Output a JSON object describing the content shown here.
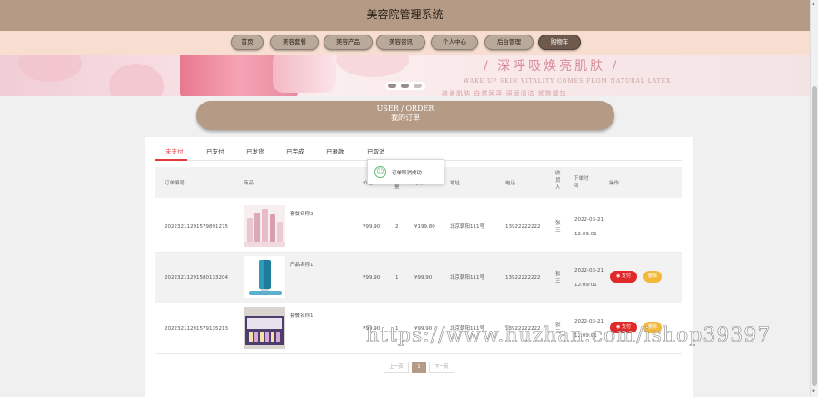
{
  "header": {
    "title": "美容院管理系统"
  },
  "nav": [
    {
      "label": "首页"
    },
    {
      "label": "美容套餐"
    },
    {
      "label": "美容产品"
    },
    {
      "label": "美容资讯"
    },
    {
      "label": "个人中心"
    },
    {
      "label": "后台管理"
    },
    {
      "label": "购物车"
    }
  ],
  "banner": {
    "slogan": "/ 深呼吸焕亮肌肤 /",
    "sub1": "WAKE UP SKIN VITALITY COMES FROM NATURAL LATEX",
    "sub2": "改善肌肤   自然润泽   深层清洁   紧致提拉"
  },
  "order_banner": {
    "en": "USER / ORDER",
    "zh": "我的订单"
  },
  "tabs": [
    {
      "label": "未支付",
      "active": true
    },
    {
      "label": "已支付"
    },
    {
      "label": "已发货"
    },
    {
      "label": "已完成"
    },
    {
      "label": "已退款"
    },
    {
      "label": "已取消"
    }
  ],
  "columns": {
    "order_no": "订单编号",
    "goods": "商品",
    "price": "价格",
    "qty": "数量",
    "total": "总价",
    "address": "地址",
    "phone": "电话",
    "receiver": "收货人",
    "time": "下单时间",
    "actions": "操作"
  },
  "rows": [
    {
      "order_no": "20223211291579891275",
      "goods_name": "套餐名称3",
      "price": "¥99.90",
      "qty": "2",
      "total": "¥199.80",
      "address": "北京朝阳111号",
      "phone": "13922222222",
      "receiver": "张三",
      "date": "2022-03-21",
      "time": "12:09:01",
      "thumb": "cosmetics-set",
      "pay_label": "",
      "del_label": ""
    },
    {
      "order_no": "20223211291580133204",
      "goods_name": "产品名称1",
      "price": "¥99.90",
      "qty": "1",
      "total": "¥99.90",
      "address": "北京朝阳111号",
      "phone": "13922222222",
      "receiver": "张三",
      "date": "2022-03-21",
      "time": "12:09:01",
      "thumb": "blue-tube",
      "pay_label": "支付",
      "del_label": "删除"
    },
    {
      "order_no": "20223211291579135213",
      "goods_name": "套餐名称1",
      "price": "¥99.90",
      "qty": "1",
      "total": "¥99.90",
      "address": "北京朝阳111号",
      "phone": "13922222222",
      "receiver": "张三",
      "date": "2022-03-21",
      "time": "12:09:01",
      "thumb": "vial-box",
      "pay_label": "支付",
      "del_label": "删除"
    }
  ],
  "pager": {
    "prev": "上一页",
    "current": "1",
    "next": "下一页"
  },
  "toast": {
    "text": "订单取消成功",
    "icon": "smile-icon"
  },
  "watermark": "https://www.huzhan.com/ishop39397",
  "colors": {
    "brand": "#b59b86",
    "active_tab": "#e4393c",
    "pay": "#e02a2a",
    "delete": "#f1b83a"
  }
}
